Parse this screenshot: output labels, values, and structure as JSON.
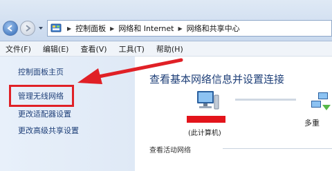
{
  "breadcrumb": {
    "items": [
      "控制面板",
      "网络和 Internet",
      "网络和共享中心"
    ]
  },
  "menu": {
    "items": [
      "文件(F)",
      "编辑(E)",
      "查看(V)",
      "工具(T)",
      "帮助(H)"
    ]
  },
  "sidebar": {
    "links": [
      "控制面板主页",
      "管理无线网络",
      "更改适配器设置",
      "更改高级共享设置"
    ]
  },
  "main": {
    "title": "查看基本网络信息并设置连接",
    "computer_label": "(此计算机)",
    "network_label": "多重",
    "section_title": "查看活动网络"
  },
  "colors": {
    "highlight": "#e02026",
    "link": "#1e3f78"
  },
  "icons": [
    "back-arrow-icon",
    "forward-arrow-icon",
    "control-panel-icon",
    "computer-icon",
    "network-icon"
  ]
}
